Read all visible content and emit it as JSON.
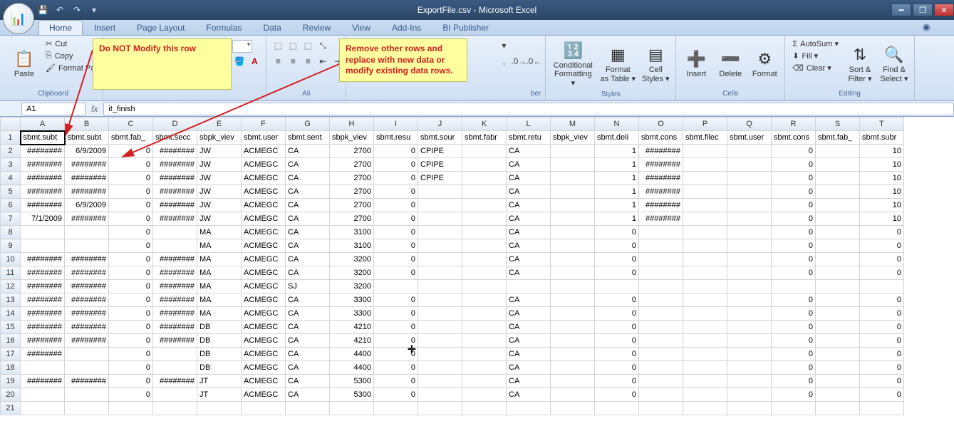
{
  "titlebar": {
    "title": "ExportFile.csv - Microsoft Excel"
  },
  "tabs": [
    "Home",
    "Insert",
    "Page Layout",
    "Formulas",
    "Data",
    "Review",
    "View",
    "Add-Ins",
    "BI Publisher"
  ],
  "active_tab": "Home",
  "ribbon": {
    "clipboard": {
      "label": "Clipboard",
      "paste": "Paste",
      "cut": "Cut",
      "copy": "Copy",
      "format_painter": "Format Pa"
    },
    "font": {
      "label": "",
      "font_name": "",
      "font_size": ""
    },
    "alignment": {
      "label": ""
    },
    "number": {
      "label": "ber"
    },
    "styles": {
      "label": "Styles",
      "cond": "Conditional\nFormatting ▾",
      "fmt_table": "Format\nas Table ▾",
      "cell_styles": "Cell\nStyles ▾"
    },
    "cells": {
      "label": "Cells",
      "insert": "Insert",
      "delete": "Delete",
      "format": "Format"
    },
    "editing": {
      "label": "Editing",
      "autosum": "AutoSum ▾",
      "fill": "Fill ▾",
      "clear": "Clear ▾",
      "sort": "Sort &\nFilter ▾",
      "find": "Find &\nSelect ▾"
    }
  },
  "callouts": {
    "left": "Do NOT Modify this row",
    "right": "Remove other rows and replace with new data or modify existing data rows."
  },
  "namebox": "A1",
  "formula": "it_finish",
  "columns": [
    "A",
    "B",
    "C",
    "D",
    "E",
    "F",
    "G",
    "H",
    "I",
    "J",
    "K",
    "L",
    "M",
    "N",
    "O",
    "P",
    "Q",
    "R",
    "S",
    "T"
  ],
  "headers_row": [
    "sbmt.subt",
    "sbmt.subt",
    "sbmt.fab_",
    "sbmt.secc",
    "sbpk_viev",
    "sbmt.user",
    "sbmt.sent",
    "sbpk_viev",
    "sbmt.resu",
    "sbmt.sour",
    "sbmt.fabr",
    "sbmt.retu",
    "sbpk_viev",
    "sbmt.deli",
    "sbmt.cons",
    "sbmt.filec",
    "sbmt.user",
    "sbmt.cons",
    "sbmt.fab_",
    "sbmt.subr"
  ],
  "rows": [
    [
      "########",
      "6/9/2009",
      "0",
      "########",
      "JW",
      "ACMEGC",
      "CA",
      "2700",
      "0",
      "CPIPE",
      "",
      "CA",
      "",
      "1",
      "########",
      "",
      "",
      "0",
      "",
      "10"
    ],
    [
      "########",
      "########",
      "0",
      "########",
      "JW",
      "ACMEGC",
      "CA",
      "2700",
      "0",
      "CPIPE",
      "",
      "CA",
      "",
      "1",
      "########",
      "",
      "",
      "0",
      "",
      "10"
    ],
    [
      "########",
      "########",
      "0",
      "########",
      "JW",
      "ACMEGC",
      "CA",
      "2700",
      "0",
      "CPIPE",
      "",
      "CA",
      "",
      "1",
      "########",
      "",
      "",
      "0",
      "",
      "10"
    ],
    [
      "########",
      "########",
      "0",
      "########",
      "JW",
      "ACMEGC",
      "CA",
      "2700",
      "0",
      "",
      "",
      "CA",
      "",
      "1",
      "########",
      "",
      "",
      "0",
      "",
      "10"
    ],
    [
      "########",
      "6/9/2009",
      "0",
      "########",
      "JW",
      "ACMEGC",
      "CA",
      "2700",
      "0",
      "",
      "",
      "CA",
      "",
      "1",
      "########",
      "",
      "",
      "0",
      "",
      "10"
    ],
    [
      "7/1/2009",
      "########",
      "0",
      "########",
      "JW",
      "ACMEGC",
      "CA",
      "2700",
      "0",
      "",
      "",
      "CA",
      "",
      "1",
      "########",
      "",
      "",
      "0",
      "",
      "10"
    ],
    [
      "",
      "",
      "0",
      "",
      "MA",
      "ACMEGC",
      "CA",
      "3100",
      "0",
      "",
      "",
      "CA",
      "",
      "0",
      "",
      "",
      "",
      "0",
      "",
      "0"
    ],
    [
      "",
      "",
      "0",
      "",
      "MA",
      "ACMEGC",
      "CA",
      "3100",
      "0",
      "",
      "",
      "CA",
      "",
      "0",
      "",
      "",
      "",
      "0",
      "",
      "0"
    ],
    [
      "########",
      "########",
      "0",
      "########",
      "MA",
      "ACMEGC",
      "CA",
      "3200",
      "0",
      "",
      "",
      "CA",
      "",
      "0",
      "",
      "",
      "",
      "0",
      "",
      "0"
    ],
    [
      "########",
      "########",
      "0",
      "########",
      "MA",
      "ACMEGC",
      "CA",
      "3200",
      "0",
      "",
      "",
      "CA",
      "",
      "0",
      "",
      "",
      "",
      "0",
      "",
      "0"
    ],
    [
      "########",
      "########",
      "0",
      "########",
      "MA",
      "ACMEGC",
      "SJ",
      "3200",
      "",
      "",
      "",
      "",
      "",
      "",
      "",
      "",
      "",
      "",
      "",
      ""
    ],
    [
      "########",
      "########",
      "0",
      "########",
      "MA",
      "ACMEGC",
      "CA",
      "3300",
      "0",
      "",
      "",
      "CA",
      "",
      "0",
      "",
      "",
      "",
      "0",
      "",
      "0"
    ],
    [
      "########",
      "########",
      "0",
      "########",
      "MA",
      "ACMEGC",
      "CA",
      "3300",
      "0",
      "",
      "",
      "CA",
      "",
      "0",
      "",
      "",
      "",
      "0",
      "",
      "0"
    ],
    [
      "########",
      "########",
      "0",
      "########",
      "DB",
      "ACMEGC",
      "CA",
      "4210",
      "0",
      "",
      "",
      "CA",
      "",
      "0",
      "",
      "",
      "",
      "0",
      "",
      "0"
    ],
    [
      "########",
      "########",
      "0",
      "########",
      "DB",
      "ACMEGC",
      "CA",
      "4210",
      "0",
      "",
      "",
      "CA",
      "",
      "0",
      "",
      "",
      "",
      "0",
      "",
      "0"
    ],
    [
      "########",
      "",
      "0",
      "",
      "DB",
      "ACMEGC",
      "CA",
      "4400",
      "0",
      "",
      "",
      "CA",
      "",
      "0",
      "",
      "",
      "",
      "0",
      "",
      "0"
    ],
    [
      "",
      "",
      "0",
      "",
      "DB",
      "ACMEGC",
      "CA",
      "4400",
      "0",
      "",
      "",
      "CA",
      "",
      "0",
      "",
      "",
      "",
      "0",
      "",
      "0"
    ],
    [
      "########",
      "########",
      "0",
      "########",
      "JT",
      "ACMEGC",
      "CA",
      "5300",
      "0",
      "",
      "",
      "CA",
      "",
      "0",
      "",
      "",
      "",
      "0",
      "",
      "0"
    ],
    [
      "",
      "",
      "0",
      "",
      "JT",
      "ACMEGC",
      "CA",
      "5300",
      "0",
      "",
      "",
      "CA",
      "",
      "0",
      "",
      "",
      "",
      "0",
      "",
      "0"
    ]
  ],
  "numeric_cols": [
    2,
    7,
    8,
    13,
    17,
    19
  ]
}
